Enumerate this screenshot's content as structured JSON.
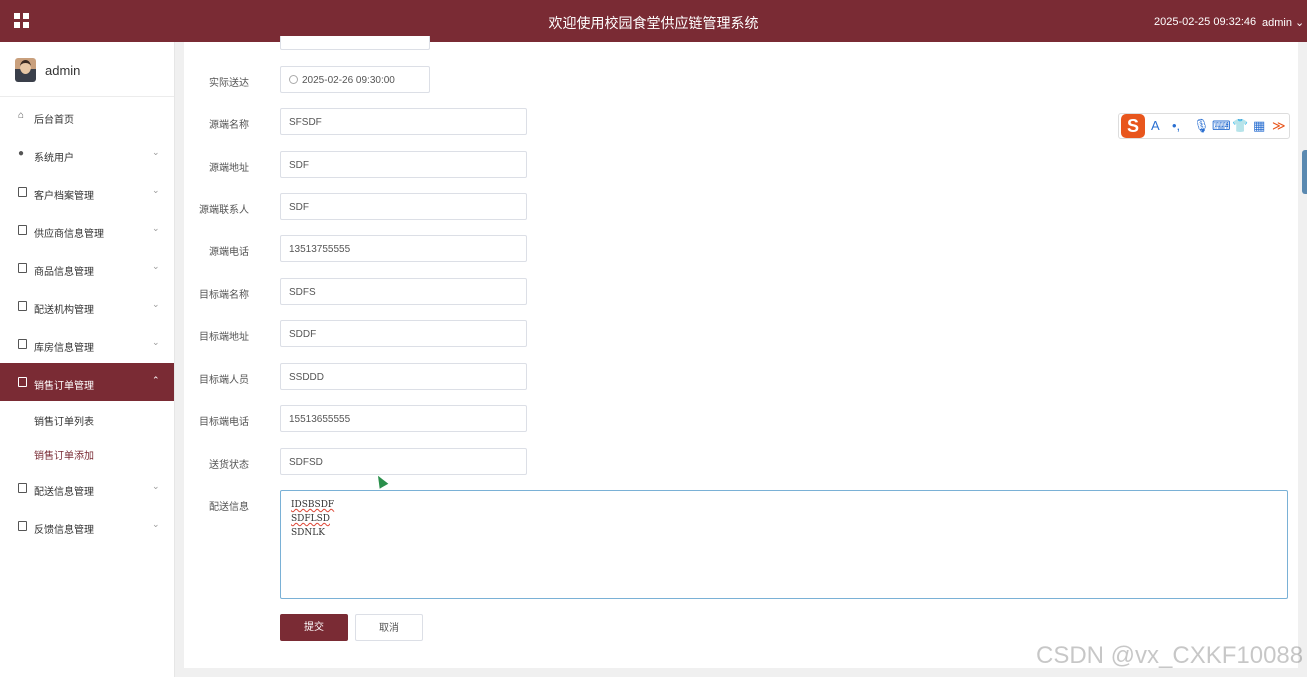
{
  "header": {
    "title": "欢迎使用校园食堂供应链管理系统",
    "datetime": "2025-02-25 09:32:46",
    "user": "admin"
  },
  "sidebar": {
    "username": "admin",
    "items": [
      {
        "label": "后台首页",
        "icon": "home-icon"
      },
      {
        "label": "系统用户",
        "icon": "user-icon"
      },
      {
        "label": "客户档案管理",
        "icon": "doc-icon"
      },
      {
        "label": "供应商信息管理",
        "icon": "doc-icon"
      },
      {
        "label": "商品信息管理",
        "icon": "doc-icon"
      },
      {
        "label": "配送机构管理",
        "icon": "doc-icon"
      },
      {
        "label": "库房信息管理",
        "icon": "doc-icon"
      },
      {
        "label": "销售订单管理",
        "icon": "doc-icon"
      },
      {
        "label": "配送信息管理",
        "icon": "doc-icon"
      },
      {
        "label": "反馈信息管理",
        "icon": "doc-icon"
      }
    ],
    "subitems": [
      {
        "label": "销售订单列表"
      },
      {
        "label": "销售订单添加"
      }
    ]
  },
  "form": {
    "fields": [
      {
        "label": "实际送达",
        "value": "2025-02-26 09:30:00"
      },
      {
        "label": "源端名称",
        "value": "SFSDF"
      },
      {
        "label": "源端地址",
        "value": "SDF"
      },
      {
        "label": "源端联系人",
        "value": "SDF"
      },
      {
        "label": "源端电话",
        "value": "13513755555"
      },
      {
        "label": "目标端名称",
        "value": "SDFS"
      },
      {
        "label": "目标端地址",
        "value": "SDDF"
      },
      {
        "label": "目标端人员",
        "value": "SSDDD"
      },
      {
        "label": "目标端电话",
        "value": "15513655555"
      },
      {
        "label": "送货状态",
        "value": "SDFSD"
      }
    ],
    "delivery_label": "配送信息",
    "delivery_lines": [
      "IDSBSDF",
      "SDFLSD",
      "SDNLK"
    ],
    "submit_label": "提交",
    "cancel_label": "取消"
  },
  "ime_toolbar": {
    "logo": "S",
    "lang": "A"
  },
  "watermark": "CSDN @vx_CXKF10088",
  "colors": {
    "brand": "#7a2b34",
    "focus_border": "#7ab1d6"
  }
}
